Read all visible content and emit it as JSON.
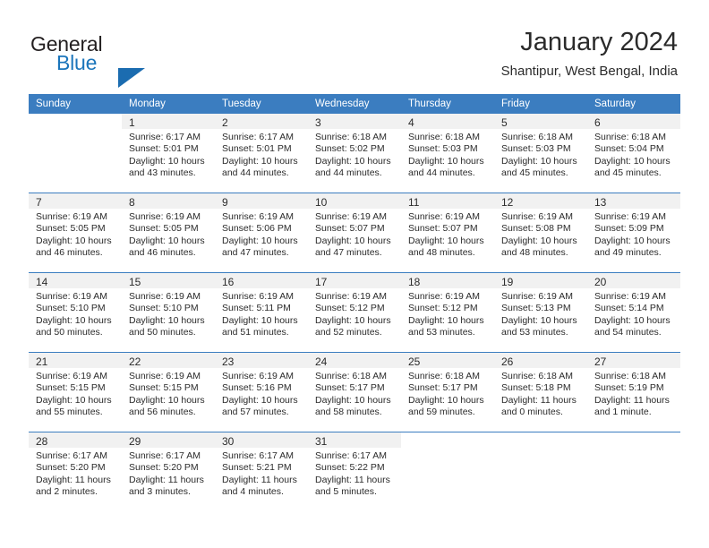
{
  "brand": {
    "line1": "General",
    "line2": "Blue",
    "triangle_color": "#1b6cb0",
    "blue_color": "#1b75bb"
  },
  "header": {
    "title": "January 2024",
    "subtitle": "Shantipur, West Bengal, India"
  },
  "theme": {
    "header_row_bg": "#3b7dc0",
    "daynum_bg": "#f1f1f1",
    "text": "#2b2b2b"
  },
  "weekday_headers": [
    "Sunday",
    "Monday",
    "Tuesday",
    "Wednesday",
    "Thursday",
    "Friday",
    "Saturday"
  ],
  "weeks": [
    [
      {
        "day": "",
        "lines": []
      },
      {
        "day": "1",
        "lines": [
          "Sunrise: 6:17 AM",
          "Sunset: 5:01 PM",
          "Daylight: 10 hours",
          "and 43 minutes."
        ]
      },
      {
        "day": "2",
        "lines": [
          "Sunrise: 6:17 AM",
          "Sunset: 5:01 PM",
          "Daylight: 10 hours",
          "and 44 minutes."
        ]
      },
      {
        "day": "3",
        "lines": [
          "Sunrise: 6:18 AM",
          "Sunset: 5:02 PM",
          "Daylight: 10 hours",
          "and 44 minutes."
        ]
      },
      {
        "day": "4",
        "lines": [
          "Sunrise: 6:18 AM",
          "Sunset: 5:03 PM",
          "Daylight: 10 hours",
          "and 44 minutes."
        ]
      },
      {
        "day": "5",
        "lines": [
          "Sunrise: 6:18 AM",
          "Sunset: 5:03 PM",
          "Daylight: 10 hours",
          "and 45 minutes."
        ]
      },
      {
        "day": "6",
        "lines": [
          "Sunrise: 6:18 AM",
          "Sunset: 5:04 PM",
          "Daylight: 10 hours",
          "and 45 minutes."
        ]
      }
    ],
    [
      {
        "day": "7",
        "lines": [
          "Sunrise: 6:19 AM",
          "Sunset: 5:05 PM",
          "Daylight: 10 hours",
          "and 46 minutes."
        ]
      },
      {
        "day": "8",
        "lines": [
          "Sunrise: 6:19 AM",
          "Sunset: 5:05 PM",
          "Daylight: 10 hours",
          "and 46 minutes."
        ]
      },
      {
        "day": "9",
        "lines": [
          "Sunrise: 6:19 AM",
          "Sunset: 5:06 PM",
          "Daylight: 10 hours",
          "and 47 minutes."
        ]
      },
      {
        "day": "10",
        "lines": [
          "Sunrise: 6:19 AM",
          "Sunset: 5:07 PM",
          "Daylight: 10 hours",
          "and 47 minutes."
        ]
      },
      {
        "day": "11",
        "lines": [
          "Sunrise: 6:19 AM",
          "Sunset: 5:07 PM",
          "Daylight: 10 hours",
          "and 48 minutes."
        ]
      },
      {
        "day": "12",
        "lines": [
          "Sunrise: 6:19 AM",
          "Sunset: 5:08 PM",
          "Daylight: 10 hours",
          "and 48 minutes."
        ]
      },
      {
        "day": "13",
        "lines": [
          "Sunrise: 6:19 AM",
          "Sunset: 5:09 PM",
          "Daylight: 10 hours",
          "and 49 minutes."
        ]
      }
    ],
    [
      {
        "day": "14",
        "lines": [
          "Sunrise: 6:19 AM",
          "Sunset: 5:10 PM",
          "Daylight: 10 hours",
          "and 50 minutes."
        ]
      },
      {
        "day": "15",
        "lines": [
          "Sunrise: 6:19 AM",
          "Sunset: 5:10 PM",
          "Daylight: 10 hours",
          "and 50 minutes."
        ]
      },
      {
        "day": "16",
        "lines": [
          "Sunrise: 6:19 AM",
          "Sunset: 5:11 PM",
          "Daylight: 10 hours",
          "and 51 minutes."
        ]
      },
      {
        "day": "17",
        "lines": [
          "Sunrise: 6:19 AM",
          "Sunset: 5:12 PM",
          "Daylight: 10 hours",
          "and 52 minutes."
        ]
      },
      {
        "day": "18",
        "lines": [
          "Sunrise: 6:19 AM",
          "Sunset: 5:12 PM",
          "Daylight: 10 hours",
          "and 53 minutes."
        ]
      },
      {
        "day": "19",
        "lines": [
          "Sunrise: 6:19 AM",
          "Sunset: 5:13 PM",
          "Daylight: 10 hours",
          "and 53 minutes."
        ]
      },
      {
        "day": "20",
        "lines": [
          "Sunrise: 6:19 AM",
          "Sunset: 5:14 PM",
          "Daylight: 10 hours",
          "and 54 minutes."
        ]
      }
    ],
    [
      {
        "day": "21",
        "lines": [
          "Sunrise: 6:19 AM",
          "Sunset: 5:15 PM",
          "Daylight: 10 hours",
          "and 55 minutes."
        ]
      },
      {
        "day": "22",
        "lines": [
          "Sunrise: 6:19 AM",
          "Sunset: 5:15 PM",
          "Daylight: 10 hours",
          "and 56 minutes."
        ]
      },
      {
        "day": "23",
        "lines": [
          "Sunrise: 6:19 AM",
          "Sunset: 5:16 PM",
          "Daylight: 10 hours",
          "and 57 minutes."
        ]
      },
      {
        "day": "24",
        "lines": [
          "Sunrise: 6:18 AM",
          "Sunset: 5:17 PM",
          "Daylight: 10 hours",
          "and 58 minutes."
        ]
      },
      {
        "day": "25",
        "lines": [
          "Sunrise: 6:18 AM",
          "Sunset: 5:17 PM",
          "Daylight: 10 hours",
          "and 59 minutes."
        ]
      },
      {
        "day": "26",
        "lines": [
          "Sunrise: 6:18 AM",
          "Sunset: 5:18 PM",
          "Daylight: 11 hours",
          "and 0 minutes."
        ]
      },
      {
        "day": "27",
        "lines": [
          "Sunrise: 6:18 AM",
          "Sunset: 5:19 PM",
          "Daylight: 11 hours",
          "and 1 minute."
        ]
      }
    ],
    [
      {
        "day": "28",
        "lines": [
          "Sunrise: 6:17 AM",
          "Sunset: 5:20 PM",
          "Daylight: 11 hours",
          "and 2 minutes."
        ]
      },
      {
        "day": "29",
        "lines": [
          "Sunrise: 6:17 AM",
          "Sunset: 5:20 PM",
          "Daylight: 11 hours",
          "and 3 minutes."
        ]
      },
      {
        "day": "30",
        "lines": [
          "Sunrise: 6:17 AM",
          "Sunset: 5:21 PM",
          "Daylight: 11 hours",
          "and 4 minutes."
        ]
      },
      {
        "day": "31",
        "lines": [
          "Sunrise: 6:17 AM",
          "Sunset: 5:22 PM",
          "Daylight: 11 hours",
          "and 5 minutes."
        ]
      },
      {
        "day": "",
        "lines": []
      },
      {
        "day": "",
        "lines": []
      },
      {
        "day": "",
        "lines": []
      }
    ]
  ]
}
